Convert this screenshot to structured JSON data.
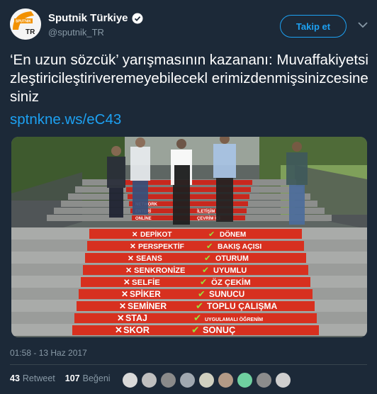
{
  "account": {
    "display_name": "Sputnik Türkiye",
    "handle": "@sputnik_TR",
    "avatar_text_top": "SPUTNIK",
    "avatar_text_bottom": "TR"
  },
  "follow_button_label": "Takip et",
  "tweet": {
    "text": "‘En uzun sözcük’ yarışmasının kazananı: Muvaffakiyetsizleştiricileştiriveremeyebilecekl erimizdenmişsinizcesinesiniz",
    "link": "sptnkne.ws/eC43"
  },
  "photo": {
    "stairs_wrong": [
      "DEPİKOT",
      "PERSPEKTİF",
      "SEANS",
      "SENKRONİZE",
      "SELFİE",
      "SPİKER",
      "SEMİNER",
      "STAJ",
      "SKOR"
    ],
    "stairs_right": [
      "DÖNEM",
      "BAKIŞ AÇISI",
      "OTURUM",
      "UYUMLU",
      "ÖZ ÇEKİM",
      "SUNUCU",
      "TOPLU ÇALIŞMA",
      "UYGULAMALI ÖĞRENİM",
      "SONUÇ"
    ],
    "upper_labels_left": [
      "NETWORK",
      "ENTERİ",
      "ONLİNE"
    ],
    "upper_labels_right": [
      "İLETİŞİM",
      "ÇEVRİM İÇİ"
    ]
  },
  "timestamp": "01:58 - 13 Haz 2017",
  "stats": {
    "retweets_count": "43",
    "retweets_label": "Retweet",
    "likes_count": "107",
    "likes_label": "Beğeni"
  },
  "liker_colors": [
    "#d9d9d9",
    "#bfbfbf",
    "#8a8a8a",
    "#a0a8b0",
    "#d0d0c0",
    "#b39a86",
    "#6fd0a0",
    "#8c8c8c",
    "#cfcfcf"
  ]
}
